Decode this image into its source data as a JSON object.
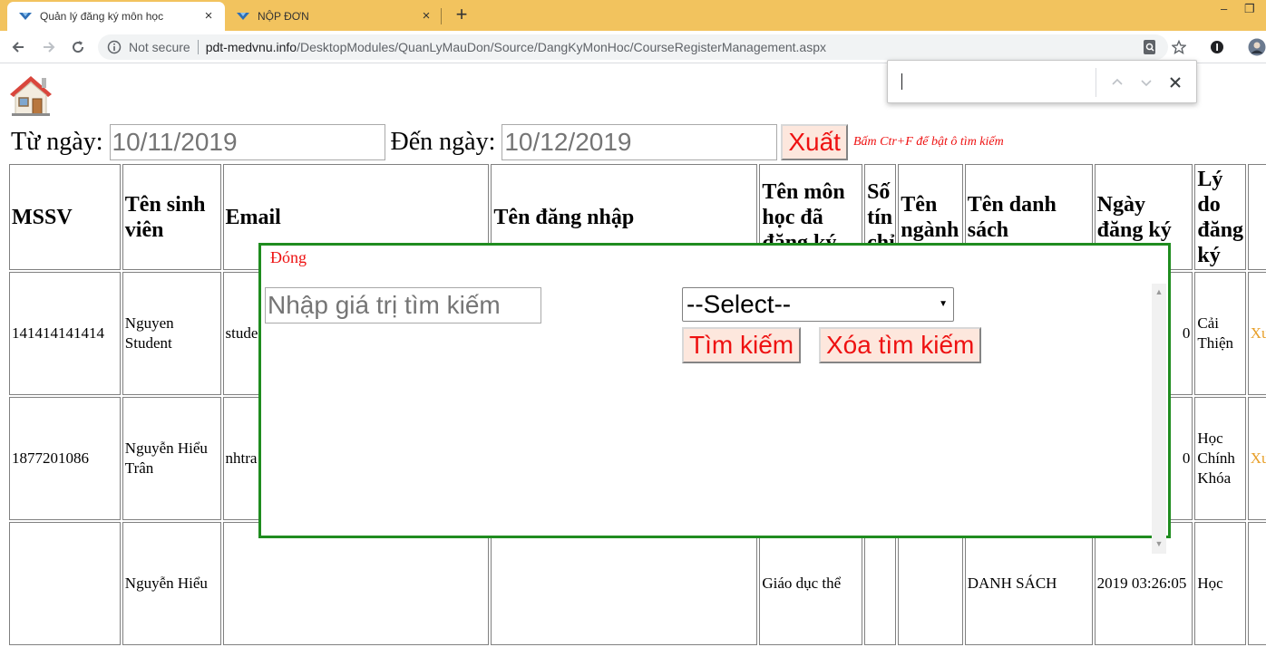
{
  "browser": {
    "tabs": [
      {
        "title": "Quản lý đăng ký môn học",
        "close": "×"
      },
      {
        "title": "NỘP ĐƠN",
        "close": "×"
      }
    ],
    "new_tab": "+",
    "window_controls": {
      "minimize": "–",
      "restore": "❐"
    },
    "address": {
      "security": "Not secure",
      "host": "pdt-medvnu.info",
      "path": "/DesktopModules/QuanLyMauDon/Source/DangKyMonHoc/CourseRegisterManagement.aspx"
    },
    "find_bar": {
      "value": ""
    }
  },
  "filters": {
    "from_label": "Từ ngày:",
    "from_value": "10/11/2019",
    "to_label": "Đến ngày:",
    "to_value": "10/12/2019",
    "export_label": "Xuất",
    "hint": "Bấm Ctr+F để bật ô tìm kiếm"
  },
  "table": {
    "headers": [
      "MSSV",
      "Tên sinh viên",
      "Email",
      "Tên đăng nhập",
      "Tên môn học đã đăng ký",
      "Số tín chỉ",
      "Tên ngành",
      "Tên danh sách",
      "Ngày đăng ký",
      "Lý do đăng ký"
    ],
    "rows": [
      {
        "mssv": "141414141414",
        "name": "Nguyen Student",
        "email": "stude",
        "date": "0",
        "reason": "Cải Thiện",
        "action": "Xu"
      },
      {
        "mssv": "1877201086",
        "name": "Nguyễn Hiểu Trân",
        "email": "nhtra",
        "date": "0",
        "reason": "Học Chính Khóa",
        "action": "Xu"
      },
      {
        "mssv": "",
        "name": "Nguyễn Hiểu",
        "email": "",
        "course": "Giáo dục thể",
        "list": "DANH SÁCH",
        "date": "2019 03:26:05",
        "reason": "Học",
        "action": ""
      }
    ]
  },
  "modal": {
    "close_label": "Đóng",
    "search_placeholder": "Nhập giá trị tìm kiếm",
    "select_value": "--Select--",
    "search_button": "Tìm kiếm",
    "clear_button": "Xóa tìm kiếm"
  },
  "colors": {
    "tab_bar": "#f2c35e",
    "modal_border": "#1f8c1f",
    "accent_red": "#e11111",
    "action_orange": "#e8a02a"
  }
}
